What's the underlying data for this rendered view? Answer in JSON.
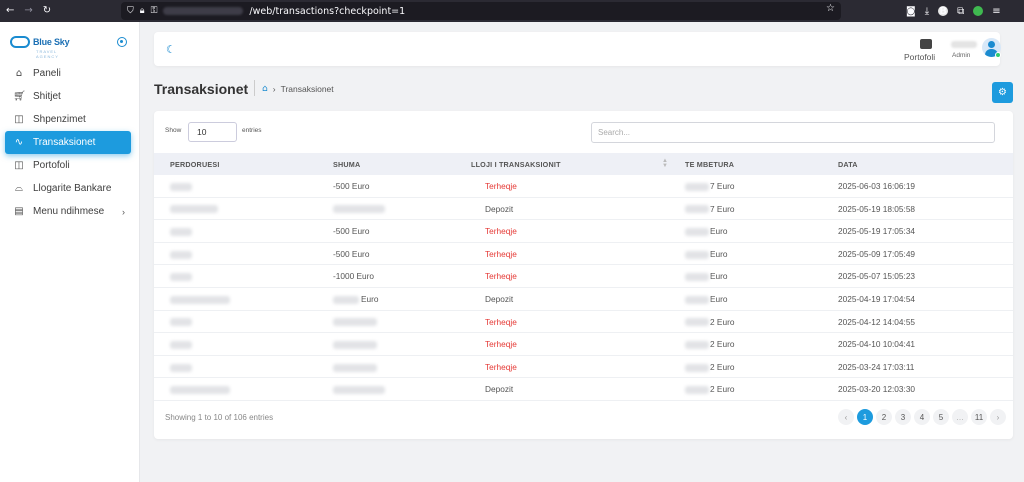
{
  "browser": {
    "url": "/web/transactions?checkpoint=1",
    "icons": [
      "back-icon",
      "forward-icon",
      "reload-icon",
      "shield-icon",
      "lock-icon",
      "key-icon",
      "bookmark-star-icon",
      "pocket-icon",
      "download-icon",
      "extensions-icon",
      "menu-icon"
    ]
  },
  "sidebar": {
    "brand": "Blue Sky",
    "brand_sub": "TRAVEL AGENCY",
    "items": [
      {
        "label": "Paneli",
        "icon": "home-icon",
        "active": false
      },
      {
        "label": "Shitjet",
        "icon": "cart-icon",
        "active": false
      },
      {
        "label": "Shpenzimet",
        "icon": "bag-icon",
        "active": false
      },
      {
        "label": "Transaksionet",
        "icon": "activity-icon",
        "active": true
      },
      {
        "label": "Portofoli",
        "icon": "bag-icon",
        "active": false
      },
      {
        "label": "Llogarite Bankare",
        "icon": "bank-icon",
        "active": false
      },
      {
        "label": "Menu ndihmese",
        "icon": "file-icon",
        "active": false
      }
    ]
  },
  "header": {
    "portofoli_label": "Portofoli",
    "user_role": "Admin"
  },
  "page": {
    "title": "Transaksionet",
    "breadcrumb_current": "Transaksionet"
  },
  "table": {
    "show_label": "Show",
    "show_value": "10",
    "entries_label": "entries",
    "search_placeholder": "Search...",
    "columns": [
      "PERDORUESI",
      "SHUMA",
      "LLOJI I TRANSAKSIONIT",
      "TE MBETURA",
      "DATA"
    ],
    "rows": [
      {
        "shuma": "-500 Euro",
        "lloji": "Terheqje",
        "mbetura": "7 Euro",
        "data": "2025-06-03 16:06:19"
      },
      {
        "shuma": "",
        "lloji": "Depozit",
        "mbetura": "7 Euro",
        "data": "2025-05-19 18:05:58"
      },
      {
        "shuma": "-500 Euro",
        "lloji": "Terheqje",
        "mbetura": "Euro",
        "data": "2025-05-19 17:05:34"
      },
      {
        "shuma": "-500 Euro",
        "lloji": "Terheqje",
        "mbetura": "Euro",
        "data": "2025-05-09 17:05:49"
      },
      {
        "shuma": "-1000 Euro",
        "lloji": "Terheqje",
        "mbetura": "Euro",
        "data": "2025-05-07 15:05:23"
      },
      {
        "shuma": "Euro",
        "lloji": "Depozit",
        "mbetura": "Euro",
        "data": "2025-04-19 17:04:54"
      },
      {
        "shuma": "",
        "lloji": "Terheqje",
        "mbetura": "2 Euro",
        "data": "2025-04-12 14:04:55"
      },
      {
        "shuma": "",
        "lloji": "Terheqje",
        "mbetura": "2 Euro",
        "data": "2025-04-10 10:04:41"
      },
      {
        "shuma": "",
        "lloji": "Terheqje",
        "mbetura": "2 Euro",
        "data": "2025-03-24 17:03:11"
      },
      {
        "shuma": "",
        "lloji": "Depozit",
        "mbetura": "2 Euro",
        "data": "2025-03-20 12:03:30"
      }
    ],
    "footer_info": "Showing 1 to 10 of 106 entries",
    "pagination": {
      "prev": "‹",
      "pages": [
        "1",
        "2",
        "3",
        "4",
        "5",
        "…",
        "11"
      ],
      "current": "1",
      "next": "›"
    }
  },
  "colors": {
    "accent": "#1d9bde",
    "withdraw": "#e53935"
  }
}
